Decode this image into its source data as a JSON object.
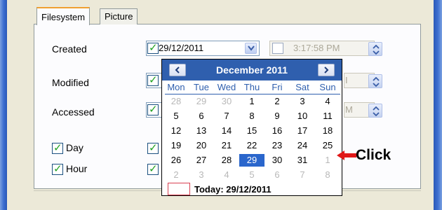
{
  "tabs": {
    "filesystem": "Filesystem",
    "picture": "Picture"
  },
  "rows": {
    "created": "Created",
    "modified": "Modified",
    "accessed": "Accessed"
  },
  "created": {
    "date": "29/12/2011",
    "time": "3:17:58 PM"
  },
  "modified": {
    "time_fragment": "I"
  },
  "accessed": {
    "time_fragment": "M"
  },
  "options": {
    "day": "Day",
    "hour": "Hour"
  },
  "calendar": {
    "month_label": "December 2011",
    "day_names": [
      "Mon",
      "Tue",
      "Wed",
      "Thu",
      "Fri",
      "Sat",
      "Sun"
    ],
    "weeks": [
      [
        "28",
        "29",
        "30",
        "1",
        "2",
        "3",
        "4"
      ],
      [
        "5",
        "6",
        "7",
        "8",
        "9",
        "10",
        "11"
      ],
      [
        "12",
        "13",
        "14",
        "15",
        "16",
        "17",
        "18"
      ],
      [
        "19",
        "20",
        "21",
        "22",
        "23",
        "24",
        "25"
      ],
      [
        "26",
        "27",
        "28",
        "29",
        "30",
        "31",
        "1"
      ],
      [
        "2",
        "3",
        "4",
        "5",
        "6",
        "7",
        "8"
      ]
    ],
    "selected_day": "29",
    "today_label": "Today: 29/12/2011"
  },
  "annotation": {
    "label": "Click"
  },
  "colors": {
    "accent": "#2f5fae",
    "selected": "#2a66cc",
    "annotation_arrow": "#e01818",
    "check": "#21a121"
  }
}
